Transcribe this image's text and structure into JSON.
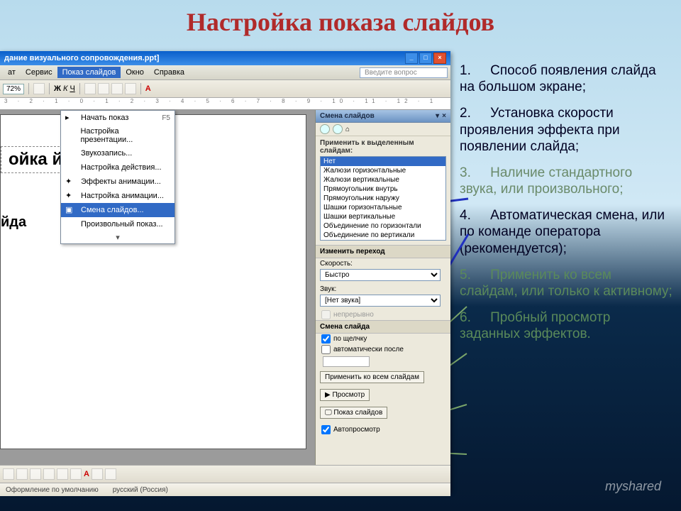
{
  "slide_title": "Настройка показа слайдов",
  "window": {
    "title": "дание визуального сопровождения.ppt]"
  },
  "menubar": {
    "items": [
      "ат",
      "Сервис",
      "Показ слайдов",
      "Окно",
      "Справка"
    ],
    "active_index": 2,
    "help_placeholder": "Введите вопрос"
  },
  "toolbar": {
    "zoom": "72%",
    "bold": "Ж",
    "italic": "К",
    "underline": "Ч"
  },
  "ruler": "3 · 2 · 1 · 0 · 1 · 2 · 3 · 4 · 5 · 6 · 7 · 8 · 9 · 10 · 11 · 12 · 1",
  "dropdown": {
    "items": [
      {
        "label": "Начать показ",
        "hotkey": "F5"
      },
      {
        "label": "Настройка презентации..."
      },
      {
        "label": "Звукозапись..."
      },
      {
        "label": "Настройка действия..."
      },
      {
        "label": "Эффекты анимации..."
      },
      {
        "label": "Настройка анимации..."
      },
      {
        "label": "Смена слайдов...",
        "highlight": true
      },
      {
        "label": "Произвольный показ..."
      }
    ]
  },
  "slide_body": {
    "h1": "ойка                    йдов",
    "h2": "йда"
  },
  "taskpane": {
    "title": "Смена слайдов",
    "apply_label": "Применить к выделенным слайдам:",
    "effects": [
      "Нет",
      "Жалюзи горизонтальные",
      "Жалюзи вертикальные",
      "Прямоугольник внутрь",
      "Прямоугольник наружу",
      "Шашки горизонтальные",
      "Шашки вертикальные",
      "Объединение по горизонтали",
      "Объединение по вертикали"
    ],
    "selected_effect_index": 0,
    "change_label": "Изменить переход",
    "speed_label": "Скорость:",
    "speed_value": "Быстро",
    "sound_label": "Звук:",
    "sound_value": "[Нет звука]",
    "loop_label": "непрерывно",
    "advance_header": "Смена слайда",
    "on_click": "по щелчку",
    "auto_after": "автоматически после",
    "apply_all": "Применить ко всем слайдам",
    "preview": "Просмотр",
    "slideshow": "Показ слайдов",
    "autopreview": "Автопросмотр"
  },
  "status": {
    "layout": "Оформление по умолчанию",
    "lang": "русский (Россия)"
  },
  "annotations": [
    {
      "n": "1.",
      "text": "Способ появления слайда на большом экране;"
    },
    {
      "n": "2.",
      "text": "Установка скорости проявления эффекта при появлении слайда;"
    },
    {
      "n": "3.",
      "text": "Наличие стандартного звука, или произвольного;"
    },
    {
      "n": "4.",
      "text": "Автоматическая смена, или по команде оператора (рекомендуется);"
    },
    {
      "n": "5.",
      "text": "Применить ко всем слайдам, или только к активному;"
    },
    {
      "n": "6.",
      "text": "Пробный просмотр заданных эффектов."
    }
  ],
  "watermark": "myshared"
}
